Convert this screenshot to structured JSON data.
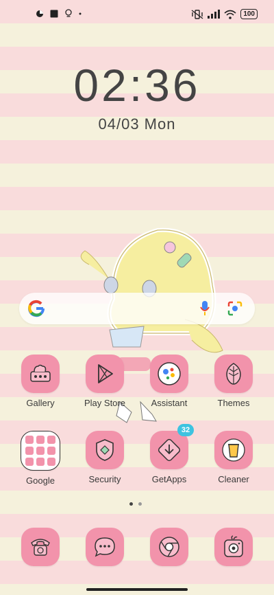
{
  "status_bar": {
    "battery": "100"
  },
  "lock": {
    "time": "02:36",
    "date": "04/03 Mon"
  },
  "apps_row1": [
    {
      "label": "Gallery",
      "icon": "gallery-icon"
    },
    {
      "label": "Play Store",
      "icon": "play-store-icon"
    },
    {
      "label": "Assistant",
      "icon": "assistant-icon"
    },
    {
      "label": "Themes",
      "icon": "themes-leaf-icon"
    }
  ],
  "apps_row2": [
    {
      "label": "Google",
      "icon": "google-folder-icon"
    },
    {
      "label": "Security",
      "icon": "security-shield-icon"
    },
    {
      "label": "GetApps",
      "icon": "getapps-icon",
      "badge": "32"
    },
    {
      "label": "Cleaner",
      "icon": "cleaner-trash-icon"
    }
  ],
  "dock": [
    {
      "icon": "phone-icon"
    },
    {
      "icon": "messages-icon"
    },
    {
      "icon": "chrome-icon"
    },
    {
      "icon": "camera-icon"
    }
  ],
  "colors": {
    "tile": "#f293ab",
    "badge": "#3ec3e0",
    "stripe_pink": "#f9dcdc",
    "stripe_cream": "#f5f1dc"
  }
}
